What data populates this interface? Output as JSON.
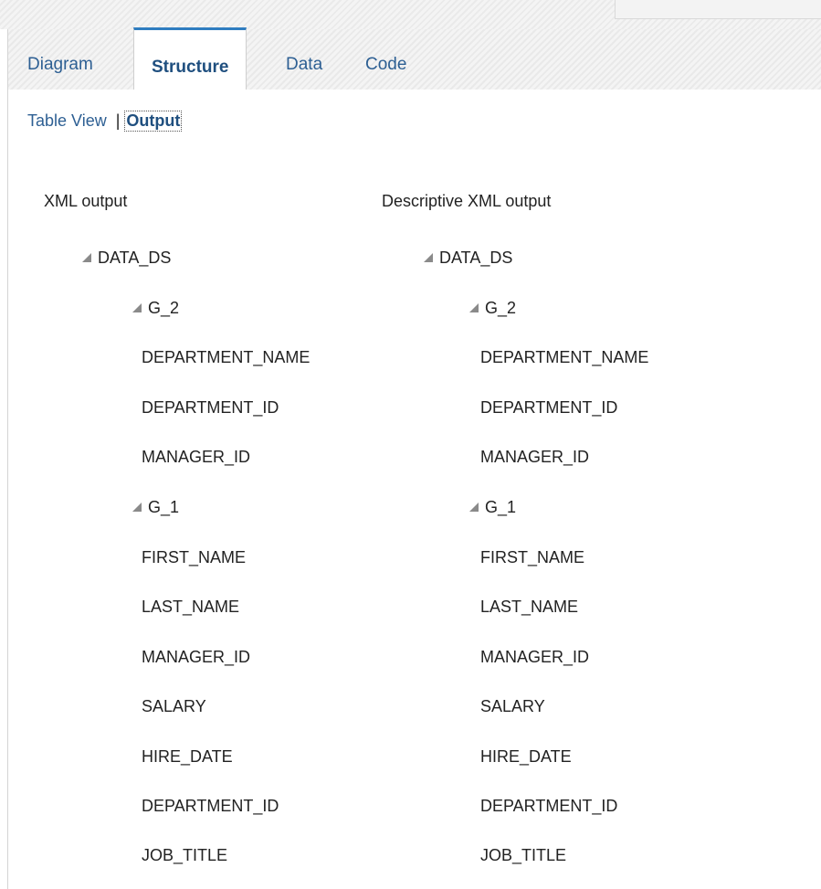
{
  "tabs": [
    "Diagram",
    "Structure",
    "Data",
    "Code"
  ],
  "subnav": {
    "table_view": "Table View",
    "separator": "|",
    "output": "Output"
  },
  "columns": [
    {
      "title": "XML output",
      "tree": {
        "root": "DATA_DS",
        "g2": "G_2",
        "g2_fields": [
          "DEPARTMENT_NAME",
          "DEPARTMENT_ID",
          "MANAGER_ID"
        ],
        "g1": "G_1",
        "g1_fields": [
          "FIRST_NAME",
          "LAST_NAME",
          "MANAGER_ID",
          "SALARY",
          "HIRE_DATE",
          "DEPARTMENT_ID",
          "JOB_TITLE"
        ]
      }
    },
    {
      "title": "Descriptive XML output",
      "tree": {
        "root": "DATA_DS",
        "g2": "G_2",
        "g2_fields": [
          "DEPARTMENT_NAME",
          "DEPARTMENT_ID",
          "MANAGER_ID"
        ],
        "g1": "G_1",
        "g1_fields": [
          "FIRST_NAME",
          "LAST_NAME",
          "MANAGER_ID",
          "SALARY",
          "HIRE_DATE",
          "DEPARTMENT_ID",
          "JOB_TITLE"
        ]
      }
    }
  ],
  "icons": {
    "expanded": "expanded-triangle-icon"
  }
}
